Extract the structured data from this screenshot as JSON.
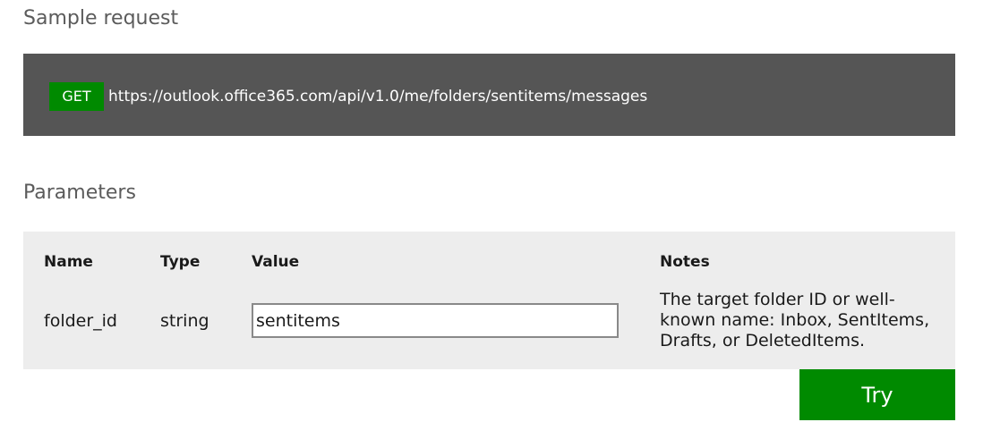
{
  "sample_request": {
    "title": "Sample request",
    "method": "GET",
    "url": "https://outlook.office365.com/api/v1.0/me/folders/sentitems/messages"
  },
  "parameters": {
    "title": "Parameters",
    "headers": {
      "name": "Name",
      "type": "Type",
      "value": "Value",
      "notes": "Notes"
    },
    "rows": [
      {
        "name": "folder_id",
        "type": "string",
        "value": "sentitems",
        "notes": "The target folder ID or well-known name: Inbox, SentItems, Drafts, or DeletedItems."
      }
    ]
  },
  "actions": {
    "try_label": "Try"
  },
  "colors": {
    "accent_green": "#008a00",
    "request_bar_bg": "#555555",
    "params_bg": "#ededed"
  }
}
